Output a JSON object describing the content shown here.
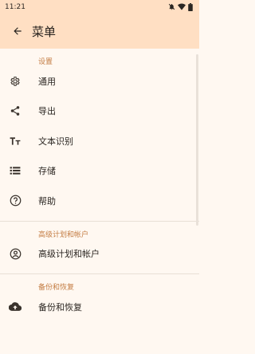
{
  "status_bar": {
    "time": "11:21"
  },
  "app_bar": {
    "title": "菜单"
  },
  "colors": {
    "accent": "#C47D44",
    "header_bg": "#FFDFC3",
    "page_bg": "#FFF8F1"
  },
  "sections": [
    {
      "header": "设置",
      "items": [
        {
          "label": "通用",
          "icon": "gear-icon"
        },
        {
          "label": "导出",
          "icon": "share-icon"
        },
        {
          "label": "文本识别",
          "icon": "text-format-icon"
        },
        {
          "label": "存储",
          "icon": "list-icon"
        },
        {
          "label": "帮助",
          "icon": "help-icon"
        }
      ]
    },
    {
      "header": "高级计划和帐户",
      "items": [
        {
          "label": "高级计划和帐户",
          "icon": "account-icon"
        }
      ]
    },
    {
      "header": "备份和恢复",
      "items": [
        {
          "label": "备份和恢复",
          "icon": "cloud-upload-icon"
        }
      ]
    }
  ]
}
